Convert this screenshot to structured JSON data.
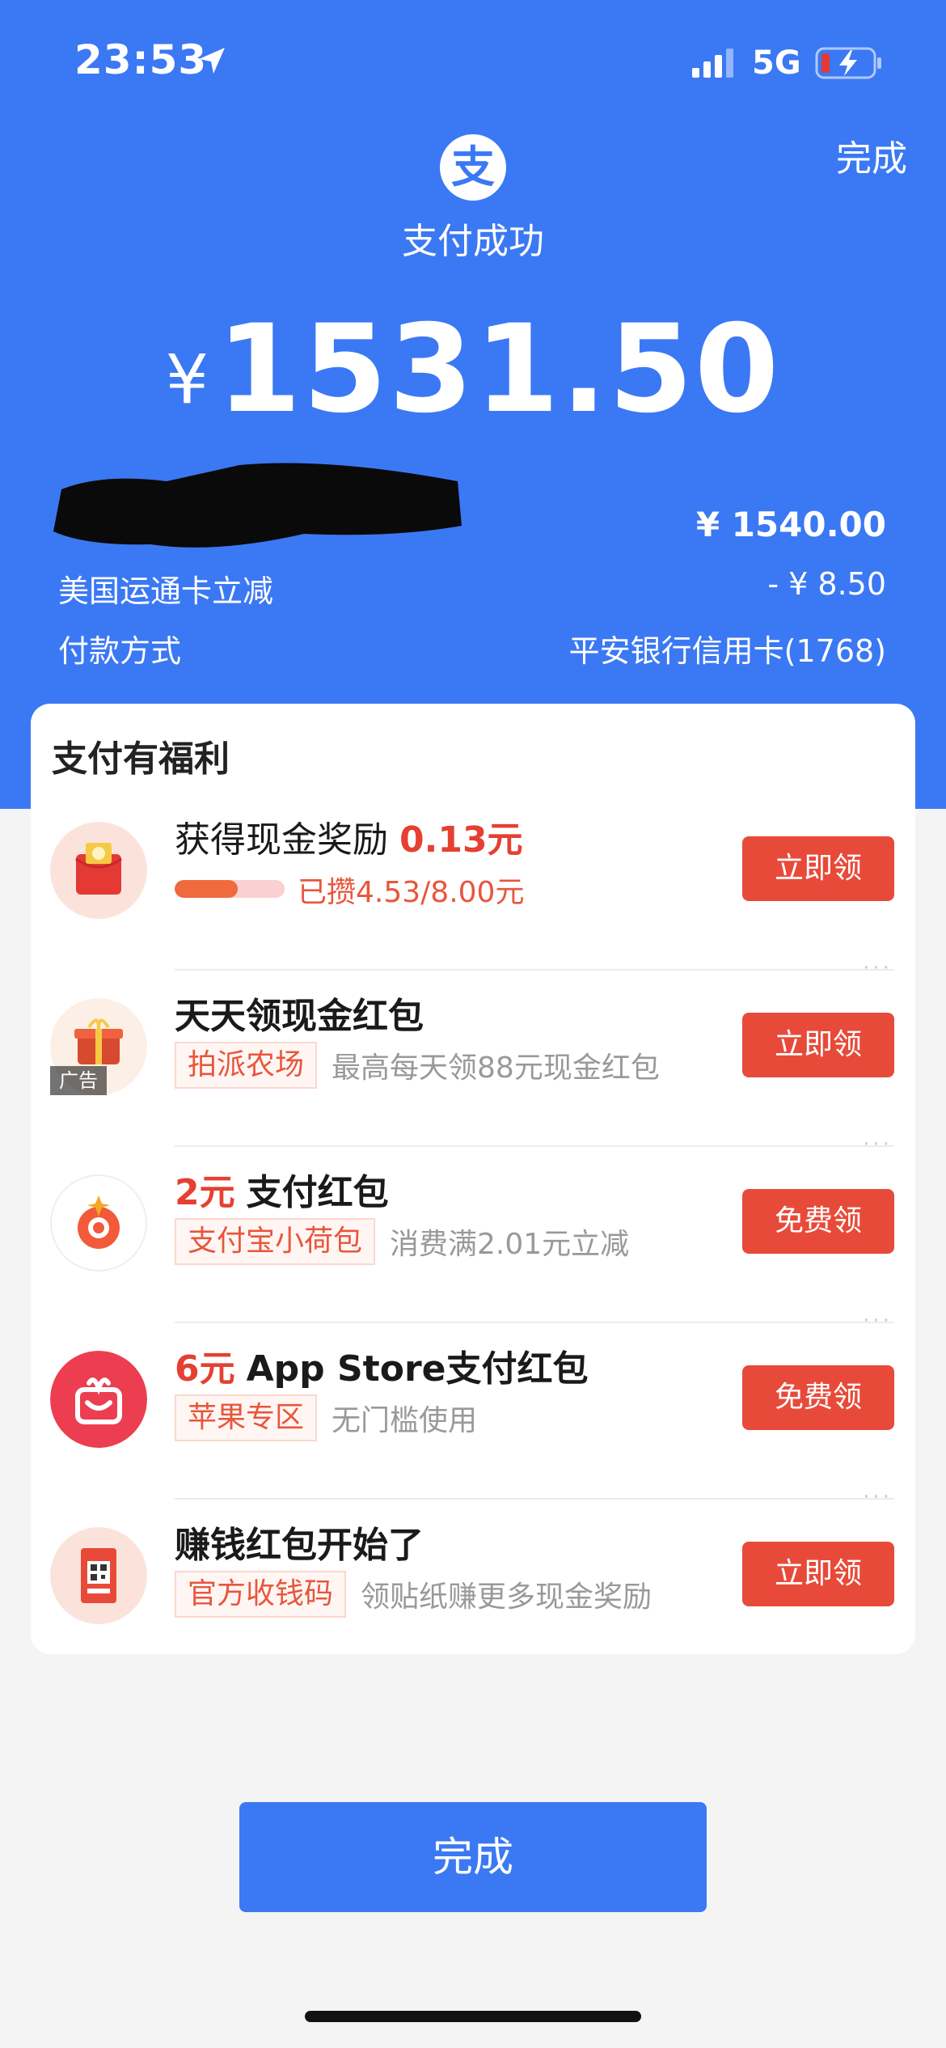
{
  "status_bar": {
    "time": "23:53",
    "network": "5G"
  },
  "header": {
    "done_label": "完成",
    "title": "支付成功",
    "currency": "¥",
    "amount": "1531.50",
    "logo_char": "支"
  },
  "summary": [
    {
      "label": "",
      "value": "¥ 1540.00"
    },
    {
      "label": "美国运通卡立减",
      "value": "- ¥ 8.50"
    },
    {
      "label": "付款方式",
      "value": "平安银行信用卡(1768)"
    }
  ],
  "benefits": {
    "title": "支付有福利",
    "items": [
      {
        "prefix": "获得现金奖励",
        "highlight": "0.13元",
        "progress_text": "已攒4.53/8.00元",
        "progress": 0.57,
        "button": "立即领"
      },
      {
        "title": "天天领现金红包",
        "tag": "拍派农场",
        "desc": "最高每天领88元现金红包",
        "ad": "广告",
        "button": "立即领",
        "more": "···"
      },
      {
        "highlight": "2元",
        "title": "支付红包",
        "tag": "支付宝小荷包",
        "desc": "消费满2.01元立减",
        "button": "免费领",
        "more": "···"
      },
      {
        "highlight": "6元",
        "title": "App Store支付红包",
        "tag": "苹果专区",
        "desc": "无门槛使用",
        "button": "免费领",
        "more": "···"
      },
      {
        "title": "赚钱红包开始了",
        "tag": "官方收钱码",
        "desc": "领贴纸赚更多现金奖励",
        "button": "立即领",
        "more": "···"
      }
    ]
  },
  "footer": {
    "done_button": "完成"
  },
  "colors": {
    "primary": "#3b78f4",
    "accent_red": "#e84a3a",
    "background": "#f4f4f4"
  }
}
